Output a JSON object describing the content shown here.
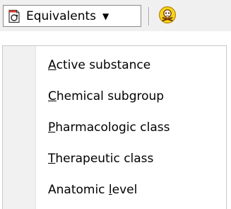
{
  "toolbar": {
    "equivalents_label": "Equivalents",
    "dropdown_icon": "document-refresh-icon",
    "caret_icon": "caret-down-icon",
    "toxic_icon": "skull-crossbones-icon",
    "colors": {
      "background": "#f0f0f0",
      "toxic_yellow": "#f5d419",
      "icon_red": "#c0392b"
    }
  },
  "menu": {
    "items": [
      {
        "mnemonic": "A",
        "label_rest": "ctive substance"
      },
      {
        "mnemonic": "C",
        "label_rest": "hemical subgroup"
      },
      {
        "mnemonic": "P",
        "label_rest": "harmacologic class"
      },
      {
        "mnemonic": "T",
        "label_rest": "herapeutic class"
      },
      {
        "label_before": "Anatomic ",
        "mnemonic": "l",
        "label_rest": "evel"
      }
    ]
  }
}
